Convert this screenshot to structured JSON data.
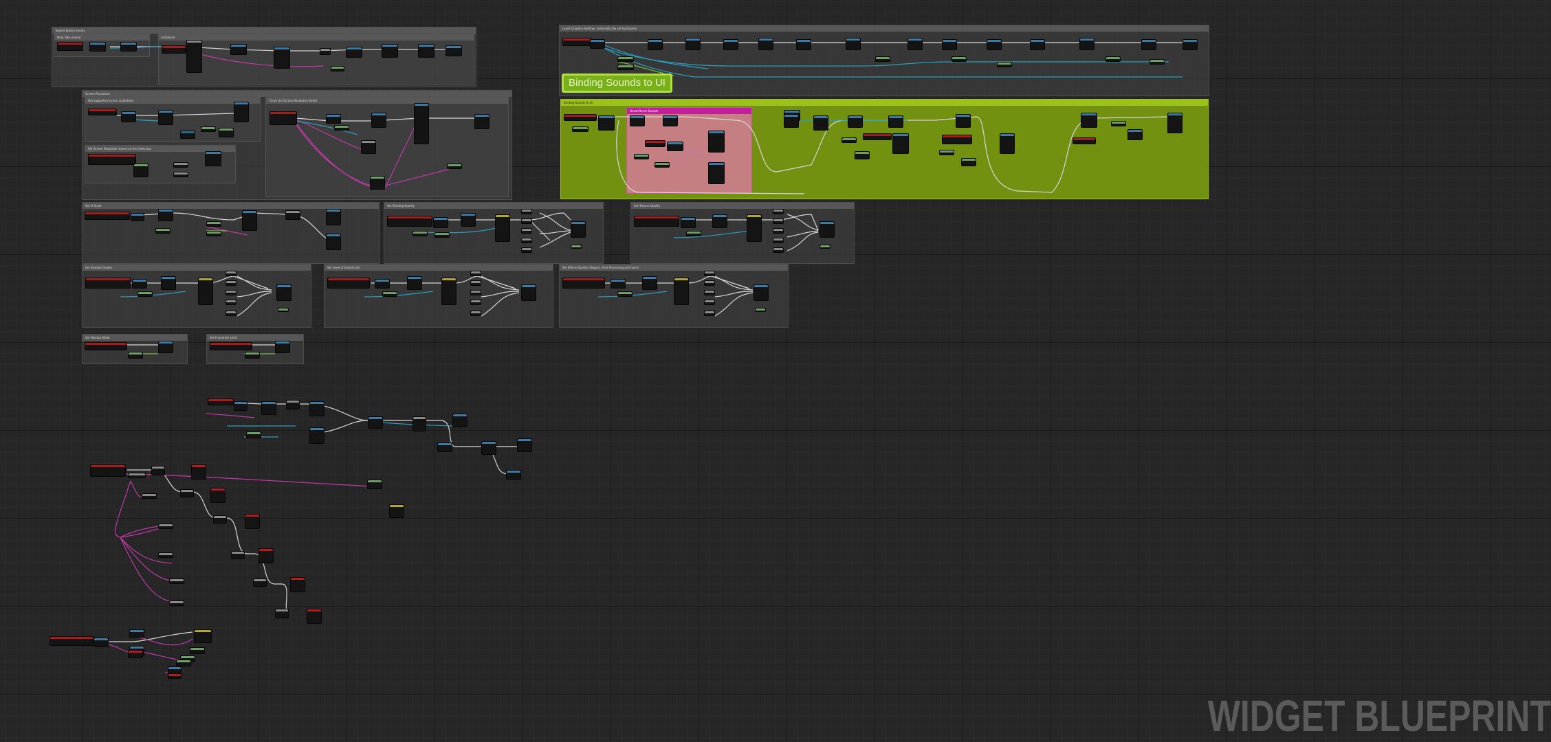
{
  "watermark": "WIDGET BLUEPRINT",
  "big_comment": "Binding Sounds to UI",
  "comments": {
    "tab_button_events": "Tabbed Button Events",
    "main_tab": "Main Tabs events",
    "initialized": "Initialized",
    "load_graphics": "Loads Graphics Settings (automatically set by Engine)",
    "screen_resolution": "Screen Resolution",
    "get_supported": "Get supported screen resolutions",
    "set_screen_res": "Set Screen Resolution based on the index box",
    "check_screen_res": "Check Set Screen Resolution Event",
    "binding_sounds_sub": "Binding Sounds to UI",
    "hover_sound": "Hover/Hover Sounds",
    "set_fi_scale": "Set FI Scale",
    "set_shading": "Set Shading Quality",
    "set_texture": "Set Texture Quality",
    "set_shadow": "Set Shadow Quality",
    "set_lod": "Set Level of Detail(LoD)",
    "set_effects": "Set Effects Quality (Niagara, Post Processing and more)",
    "set_window_mode": "Set Window Mode",
    "set_framerate": "Set Framerate Limit"
  },
  "colors": {
    "event_node": "#a51d1d",
    "function_node": "#3e7aa3",
    "pure_node": "#6ea064",
    "select_node": "#b4a826",
    "comment_green": "#80a40e",
    "comment_pink": "#e278a8",
    "exec_wire": "#d8d8d8",
    "object_wire": "#2a9ec0",
    "enum_wire": "#c03aa8",
    "float_wire": "#7ab83c"
  }
}
